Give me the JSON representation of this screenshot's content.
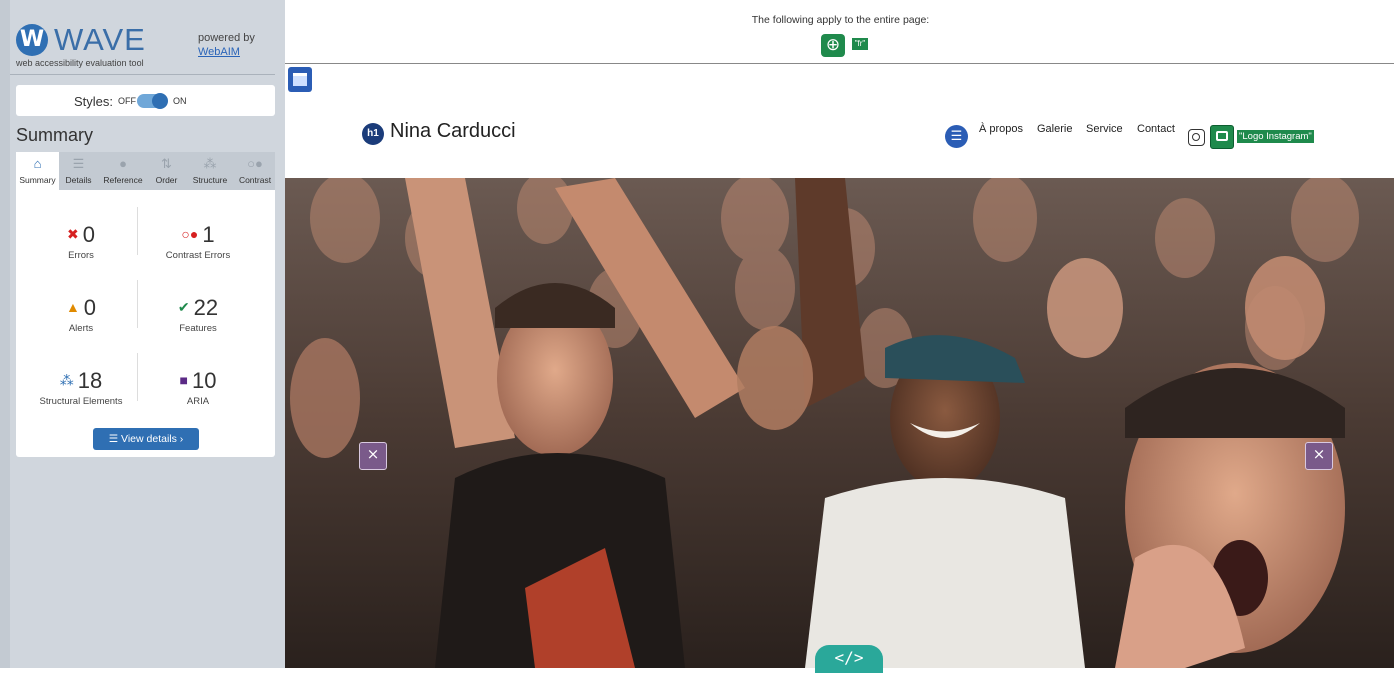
{
  "wave": {
    "logo_letter": "W",
    "logo_text": "WAVE",
    "tagline": "web accessibility evaluation tool",
    "powered_by": "powered by",
    "webaim_link": "WebAIM",
    "styles_label": "Styles:",
    "styles_off": "OFF",
    "styles_on": "ON",
    "summary_title": "Summary",
    "tabs": [
      {
        "label": "Summary",
        "icon": "home-icon",
        "glyph": "⌂"
      },
      {
        "label": "Details",
        "icon": "list-icon",
        "glyph": "☰"
      },
      {
        "label": "Reference",
        "icon": "info-icon",
        "glyph": "●"
      },
      {
        "label": "Order",
        "icon": "order-icon",
        "glyph": "⇅"
      },
      {
        "label": "Structure",
        "icon": "structure-icon",
        "glyph": "⁂"
      },
      {
        "label": "Contrast",
        "icon": "contrast-icon",
        "glyph": "○●"
      }
    ],
    "stats": {
      "errors": {
        "value": "0",
        "label": "Errors",
        "symbol": "✖"
      },
      "contrast_errors": {
        "value": "1",
        "label": "Contrast Errors",
        "symbol": "○●"
      },
      "alerts": {
        "value": "0",
        "label": "Alerts",
        "symbol": "▲"
      },
      "features": {
        "value": "22",
        "label": "Features",
        "symbol": "✔"
      },
      "structural": {
        "value": "18",
        "label": "Structural Elements",
        "symbol": "⁂"
      },
      "aria": {
        "value": "10",
        "label": "ARIA",
        "symbol": "■"
      }
    },
    "view_details": "☰  View details ›",
    "colors": {
      "accent": "#2f6fb3",
      "error": "#d62020",
      "alert": "#e08a00",
      "feature": "#1f8a4c",
      "aria": "#5b2a86"
    }
  },
  "page": {
    "notice": "The following apply to the entire page:",
    "lang_badge": "\"fr\"",
    "h1_badge": "h1",
    "site_title": "Nina Carducci",
    "nav": [
      "À propos",
      "Galerie",
      "Service",
      "Contact"
    ],
    "alt_badge": "\"Logo Instagram\"",
    "code_icon": "</>"
  }
}
